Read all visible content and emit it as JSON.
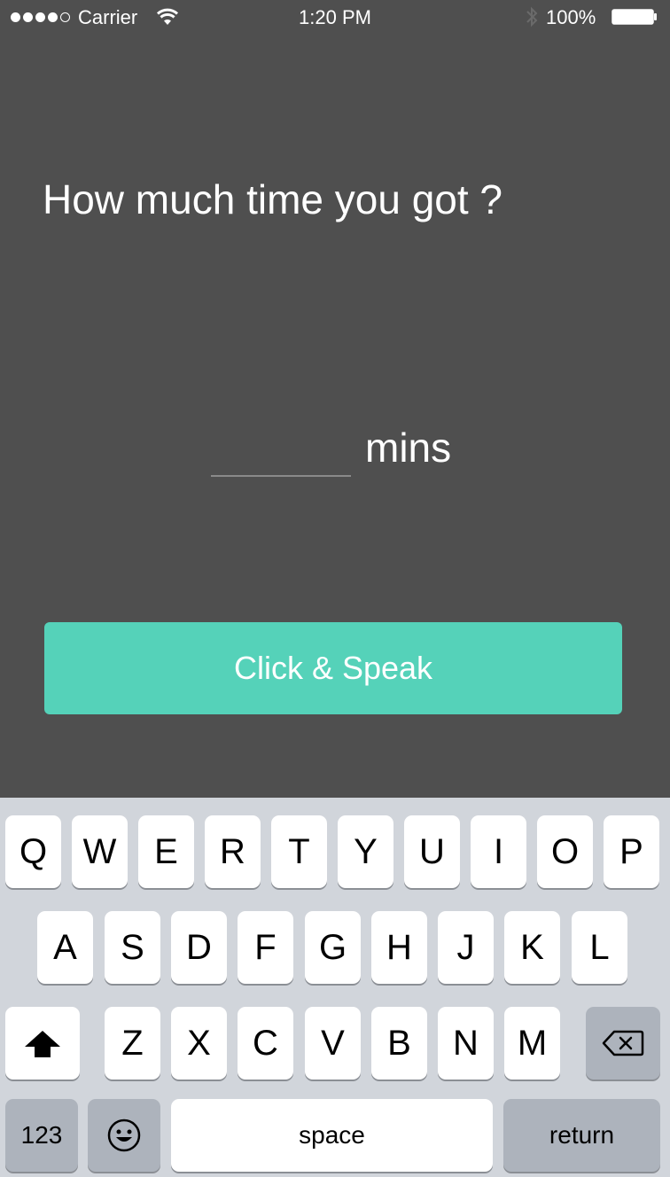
{
  "status_bar": {
    "carrier": "Carrier",
    "time": "1:20 PM",
    "battery_percent": "100%",
    "signal_bars": 4,
    "signal_total": 5,
    "icons": [
      "signal-dots",
      "wifi-icon",
      "bluetooth-icon",
      "battery-icon"
    ]
  },
  "main": {
    "question": "How much time you got ?",
    "time_input": {
      "value": "",
      "placeholder": ""
    },
    "unit_label": "mins",
    "speak_button_label": "Click & Speak"
  },
  "colors": {
    "background": "#4f4f4f",
    "accent": "#55d2b9",
    "text": "#ffffff",
    "keyboard_background": "#d1d5db",
    "key_background": "#ffffff",
    "key_dark_background": "#adb3bc"
  },
  "keyboard": {
    "row1": [
      "Q",
      "W",
      "E",
      "R",
      "T",
      "Y",
      "U",
      "I",
      "O",
      "P"
    ],
    "row2": [
      "A",
      "S",
      "D",
      "F",
      "G",
      "H",
      "J",
      "K",
      "L"
    ],
    "row3": [
      "Z",
      "X",
      "C",
      "V",
      "B",
      "N",
      "M"
    ],
    "shift_icon": "shift-arrow-icon",
    "delete_icon": "delete-backspace-icon",
    "numbers_label": "123",
    "emoji_icon": "emoji-smiley-icon",
    "space_label": "space",
    "return_label": "return"
  }
}
